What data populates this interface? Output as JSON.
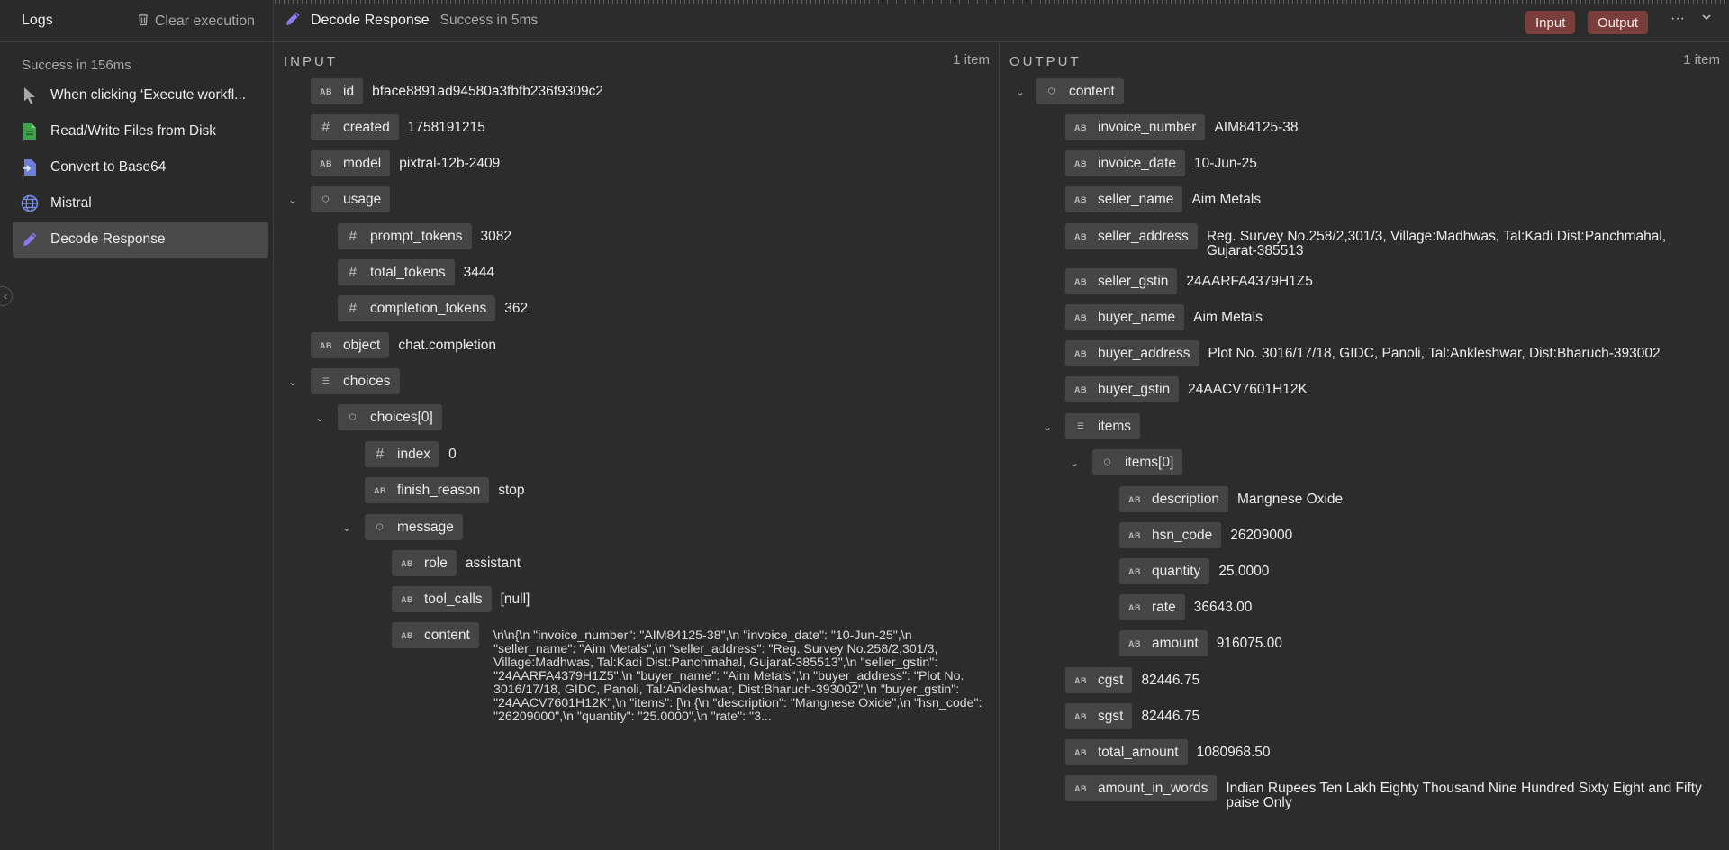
{
  "sidebar": {
    "title": "Logs",
    "clear_label": "Clear execution",
    "status": "Success in 156ms",
    "items": [
      {
        "label": "When clicking ‘Execute workfl...",
        "icon": "cursor-icon"
      },
      {
        "label": "Read/Write Files from Disk",
        "icon": "file-icon"
      },
      {
        "label": "Convert to Base64",
        "icon": "convert-file-icon"
      },
      {
        "label": "Mistral",
        "icon": "globe-icon"
      },
      {
        "label": "Decode Response",
        "icon": "pencil-icon"
      }
    ]
  },
  "header": {
    "title": "Decode Response",
    "status": "Success in 5ms",
    "input_label": "Input",
    "output_label": "Output",
    "more": "···",
    "collapse": "⌄"
  },
  "colors": {
    "accent_pill": "#7a3e3b",
    "pencil": "#8b7cf0",
    "file_green": "#3fa34d",
    "blue_icon": "#6b7fd6"
  },
  "input": {
    "label": "INPUT",
    "count": "1 item",
    "nodes": {
      "id": {
        "key": "id",
        "value": "bface8891ad94580a3fbfb236f9309c2"
      },
      "created": {
        "key": "created",
        "value": "1758191215"
      },
      "model": {
        "key": "model",
        "value": "pixtral-12b-2409"
      },
      "usage": {
        "key": "usage"
      },
      "prompt_tokens": {
        "key": "prompt_tokens",
        "value": "3082"
      },
      "total_tokens": {
        "key": "total_tokens",
        "value": "3444"
      },
      "completion_tokens": {
        "key": "completion_tokens",
        "value": "362"
      },
      "object": {
        "key": "object",
        "value": "chat.completion"
      },
      "choices": {
        "key": "choices"
      },
      "choices0": {
        "key": "choices[0]"
      },
      "index": {
        "key": "index",
        "value": "0"
      },
      "finish_reason": {
        "key": "finish_reason",
        "value": "stop"
      },
      "message": {
        "key": "message"
      },
      "role": {
        "key": "role",
        "value": "assistant"
      },
      "tool_calls": {
        "key": "tool_calls",
        "value": "[null]"
      },
      "content": {
        "key": "content",
        "value": "\\n\\n{\\n \"invoice_number\": \"AIM84125-38\",\\n \"invoice_date\": \"10-Jun-25\",\\n \"seller_name\": \"Aim Metals\",\\n \"seller_address\": \"Reg. Survey No.258/2,301/3, Village:Madhwas, Tal:Kadi Dist:Panchmahal, Gujarat-385513\",\\n \"seller_gstin\": \"24AARFA4379H1Z5\",\\n \"buyer_name\": \"Aim Metals\",\\n \"buyer_address\": \"Plot No. 3016/17/18, GIDC, Panoli, Tal:Ankleshwar, Dist:Bharuch-393002\",\\n \"buyer_gstin\": \"24AACV7601H12K\",\\n \"items\": [\\n {\\n \"description\": \"Mangnese Oxide\",\\n \"hsn_code\": \"26209000\",\\n \"quantity\": \"25.0000\",\\n \"rate\": \"3..."
      }
    }
  },
  "output": {
    "label": "OUTPUT",
    "count": "1 item",
    "nodes": {
      "content": {
        "key": "content"
      },
      "invoice_number": {
        "key": "invoice_number",
        "value": "AIM84125-38"
      },
      "invoice_date": {
        "key": "invoice_date",
        "value": "10-Jun-25"
      },
      "seller_name": {
        "key": "seller_name",
        "value": "Aim Metals"
      },
      "seller_address": {
        "key": "seller_address",
        "value": "Reg. Survey No.258/2,301/3, Village:Madhwas, Tal:Kadi Dist:Panchmahal, Gujarat-385513"
      },
      "seller_gstin": {
        "key": "seller_gstin",
        "value": "24AARFA4379H1Z5"
      },
      "buyer_name": {
        "key": "buyer_name",
        "value": "Aim Metals"
      },
      "buyer_address": {
        "key": "buyer_address",
        "value": "Plot No. 3016/17/18, GIDC, Panoli, Tal:Ankleshwar, Dist:Bharuch-393002"
      },
      "buyer_gstin": {
        "key": "buyer_gstin",
        "value": "24AACV7601H12K"
      },
      "items": {
        "key": "items"
      },
      "items0": {
        "key": "items[0]"
      },
      "description": {
        "key": "description",
        "value": "Mangnese Oxide"
      },
      "hsn_code": {
        "key": "hsn_code",
        "value": "26209000"
      },
      "quantity": {
        "key": "quantity",
        "value": "25.0000"
      },
      "rate": {
        "key": "rate",
        "value": "36643.00"
      },
      "amount": {
        "key": "amount",
        "value": "916075.00"
      },
      "cgst": {
        "key": "cgst",
        "value": "82446.75"
      },
      "sgst": {
        "key": "sgst",
        "value": "82446.75"
      },
      "total_amount": {
        "key": "total_amount",
        "value": "1080968.50"
      },
      "amount_in_words": {
        "key": "amount_in_words",
        "value": "Indian Rupees Ten Lakh Eighty Thousand Nine Hundred Sixty Eight and Fifty paise Only"
      }
    }
  }
}
